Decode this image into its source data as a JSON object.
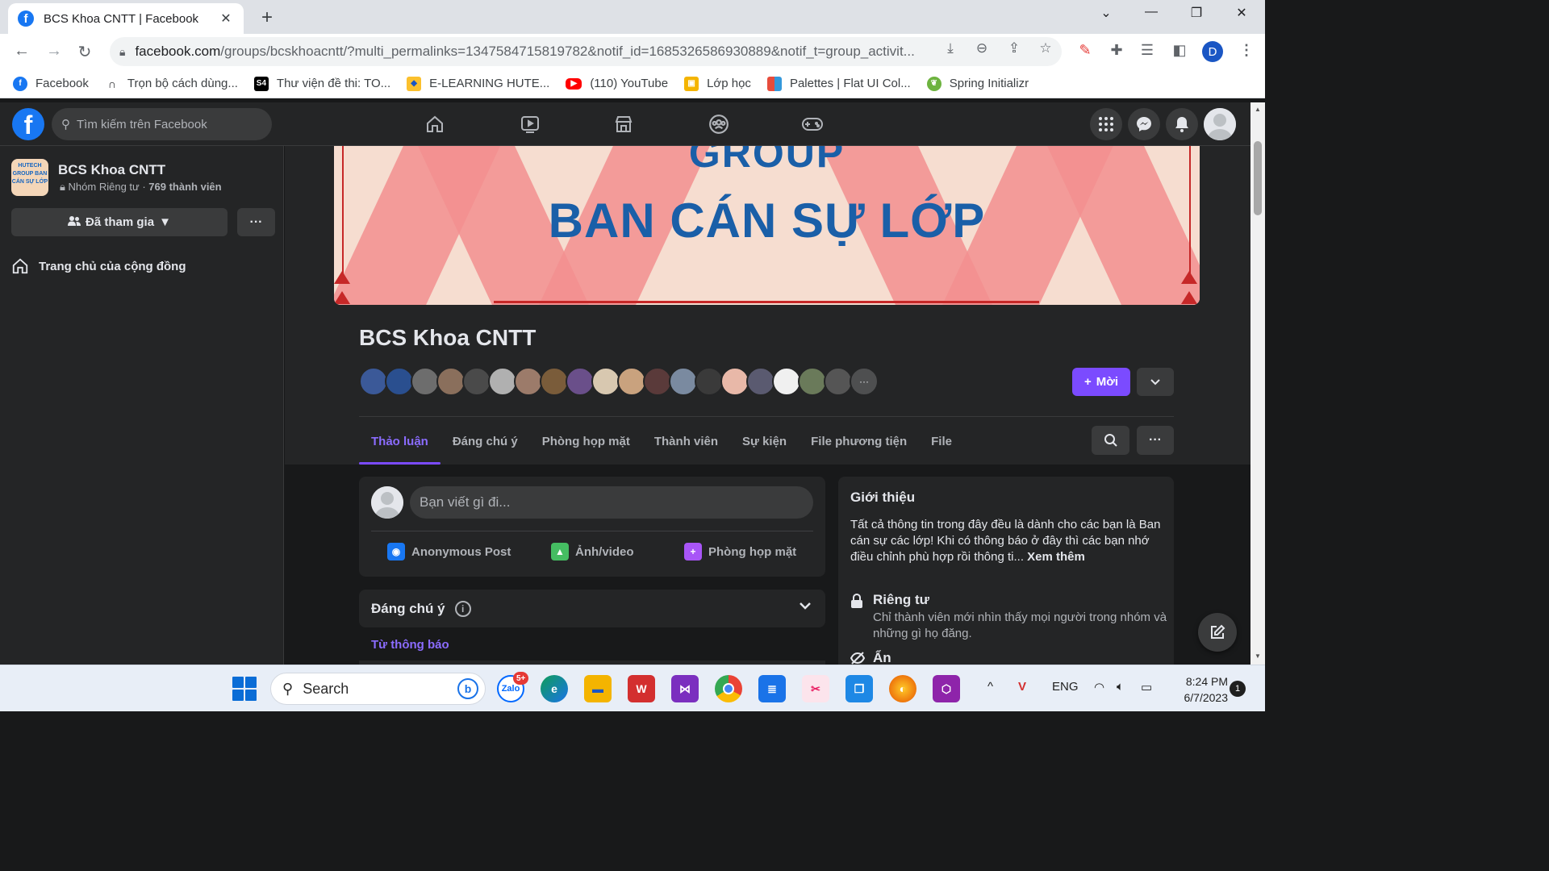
{
  "browser": {
    "tab_title": "BCS Khoa CNTT | Facebook",
    "url_host": "facebook.com",
    "url_rest": "/groups/bcskhoacntt/?multi_permalinks=1347584715819782&notif_id=1685326586930889&notif_t=group_activit...",
    "profile_initial": "D",
    "bookmarks": [
      {
        "label": "Facebook",
        "color": "#1877f2"
      },
      {
        "label": "Trọn bộ cách dùng...",
        "color": "#202124"
      },
      {
        "label": "Thư viện đề thi: TO...",
        "color": "#000000"
      },
      {
        "label": "E-LEARNING HUTE...",
        "color": "#1a56c4"
      },
      {
        "label": "(110) YouTube",
        "color": "#ff0000"
      },
      {
        "label": "Lớp học",
        "color": "#f4b400"
      },
      {
        "label": "Palettes | Flat UI Col...",
        "color": "#e74c3c"
      },
      {
        "label": "Spring Initializr",
        "color": "#6db33f"
      }
    ]
  },
  "header": {
    "search_placeholder": "Tìm kiếm trên Facebook"
  },
  "sidebar": {
    "group_name": "BCS Khoa CNTT",
    "group_meta_privacy": "Nhóm Riêng tư",
    "group_meta_members": "769 thành viên",
    "thumb_text": "HUTECH GROUP BAN CÁN SỰ LỚP",
    "joined_label": "Đã tham gia",
    "more_label": "···",
    "community_home_label": "Trang chủ của cộng đồng"
  },
  "cover": {
    "line1": "GROUP",
    "line2": "BAN CÁN SỰ LỚP"
  },
  "group": {
    "title": "BCS Khoa CNTT",
    "new_button": "Mời",
    "member_avatar_colors": [
      "#3b5998",
      "#2a4f8f",
      "#6d6d6d",
      "#8a6f5c",
      "#4a4a4a",
      "#b0b0b0",
      "#9c7b6a",
      "#7a5c3a",
      "#6a4f8a",
      "#d8c8b0",
      "#c9a27e",
      "#5a3a3a",
      "#7a8aa0",
      "#3a3a3a",
      "#e8b8a8",
      "#5a5a70",
      "#f0f0f0",
      "#6a7a5a",
      "#555555"
    ],
    "tabs": [
      "Thảo luận",
      "Đáng chú ý",
      "Phòng họp mặt",
      "Thành viên",
      "Sự kiện",
      "File phương tiện",
      "File"
    ],
    "active_tab": "Thảo luận"
  },
  "composer": {
    "placeholder": "Bạn viết gì đi...",
    "actions": [
      {
        "label": "Anonymous Post",
        "color": "#1877f2"
      },
      {
        "label": "Ảnh/video",
        "color": "#45bd62"
      },
      {
        "label": "Phòng họp mặt",
        "color": "#a855f7"
      }
    ]
  },
  "notable": {
    "title": "Đáng chú ý",
    "info_icon": "i",
    "from_notice": "Từ thông báo"
  },
  "about": {
    "title": "Giới thiệu",
    "description": "Tất cả thông tin trong đây đều là dành cho các bạn là Ban cán sự các lớp! Khi có thông báo ở đây thì các bạn nhớ điều chỉnh phù hợp rồi thông ti...",
    "see_more": "Xem thêm",
    "private_title": "Riêng tư",
    "private_desc": "Chỉ thành viên mới nhìn thấy mọi người trong nhóm và những gì họ đăng.",
    "hidden_title": "Ẩn"
  },
  "taskbar": {
    "search_label": "Search",
    "zalo_badge": "5+",
    "lang": "ENG",
    "time": "8:24 PM",
    "date": "6/7/2023",
    "notif_count": "1"
  }
}
